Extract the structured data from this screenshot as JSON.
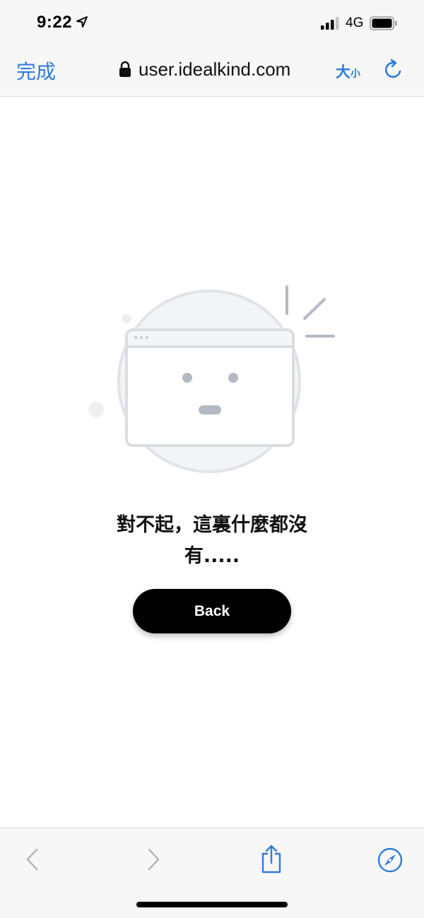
{
  "status": {
    "time": "9:22",
    "network": "4G"
  },
  "nav": {
    "done_label": "完成",
    "url": "user.idealkind.com",
    "text_size_big": "大",
    "text_size_small": "小"
  },
  "page": {
    "message": "對不起，這裏什麼都沒有.....",
    "back_label": "Back"
  },
  "icons": {
    "location": "location-arrow-icon",
    "signal": "cellular-signal-icon",
    "battery": "battery-icon",
    "lock": "lock-icon",
    "reload": "reload-icon",
    "back": "chevron-left-icon",
    "forward": "chevron-right-icon",
    "share": "share-icon",
    "compass": "compass-icon"
  },
  "colors": {
    "accent": "#2f7bdb",
    "illustration_stroke": "#dcdde3",
    "illustration_feature": "#b4bac4"
  }
}
